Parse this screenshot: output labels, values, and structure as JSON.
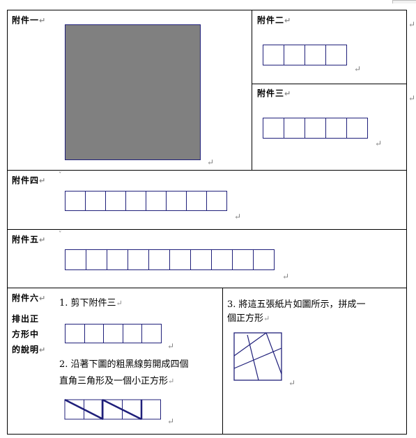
{
  "page_mark": "",
  "annex1": {
    "label": "附件一"
  },
  "annex2": {
    "label": "附件二",
    "squares": 4
  },
  "annex3": {
    "label": "附件三",
    "squares": 5
  },
  "annex4": {
    "label": "附件四",
    "squares": 8
  },
  "annex5": {
    "label": "附件五",
    "squares": 10
  },
  "annex6": {
    "label": "附件六",
    "sub_label_1": "排出正",
    "sub_label_2": "方形中",
    "sub_label_3": "的說明",
    "step1": "1. 剪下附件三",
    "step2_line1": "2. 沿著下圖的粗黑線剪開成四個",
    "step2_line2": "直角三角形及一個小正方形",
    "step3_line1": "3. 將這五張紙片如圖所示，拼成一",
    "step3_line2": "個正方形",
    "squares": 5
  },
  "colors": {
    "grid_line": "#1f1f7a",
    "gray_square": "#808080"
  },
  "para_mark": "↵"
}
